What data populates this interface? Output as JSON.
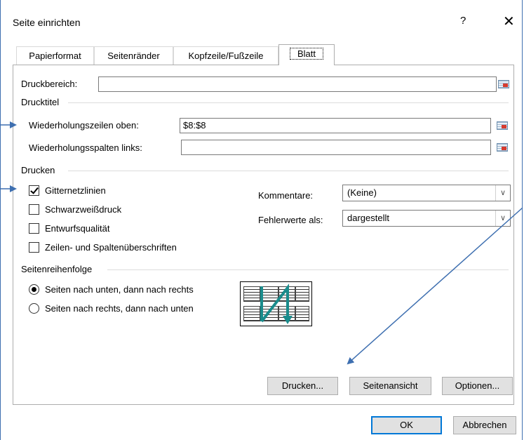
{
  "window": {
    "title": "Seite einrichten",
    "help_label": "?",
    "close_label": "✕"
  },
  "tabs": [
    {
      "label": "Papierformat"
    },
    {
      "label": "Seitenränder"
    },
    {
      "label": "Kopfzeile/Fußzeile"
    },
    {
      "label": "Blatt",
      "active": true
    }
  ],
  "print_area": {
    "label": "Druckbereich:",
    "value": ""
  },
  "print_titles": {
    "group_label": "Drucktitel",
    "rows_label": "Wiederholungszeilen oben:",
    "rows_value": "$8:$8",
    "cols_label": "Wiederholungsspalten links:",
    "cols_value": ""
  },
  "print": {
    "group_label": "Drucken",
    "checkboxes": [
      {
        "label": "Gitternetzlinien",
        "checked": true
      },
      {
        "label": "Schwarzweißdruck",
        "checked": false
      },
      {
        "label": "Entwurfsqualität",
        "checked": false
      },
      {
        "label": "Zeilen- und Spaltenüberschriften",
        "checked": false
      }
    ],
    "comments_label": "Kommentare:",
    "comments_value": "(Keine)",
    "errors_label": "Fehlerwerte als:",
    "errors_value": "dargestellt"
  },
  "page_order": {
    "group_label": "Seitenreihenfolge",
    "options": [
      {
        "label": "Seiten nach unten, dann nach rechts",
        "selected": true
      },
      {
        "label": "Seiten nach rechts, dann nach unten",
        "selected": false
      }
    ]
  },
  "buttons": {
    "print": "Drucken...",
    "preview": "Seitenansicht",
    "options": "Optionen...",
    "ok": "OK",
    "cancel": "Abbrechen"
  },
  "colors": {
    "accent": "#0078d7",
    "annotation": "#3e6fb0",
    "order_arrow": "#1a8c8c"
  }
}
